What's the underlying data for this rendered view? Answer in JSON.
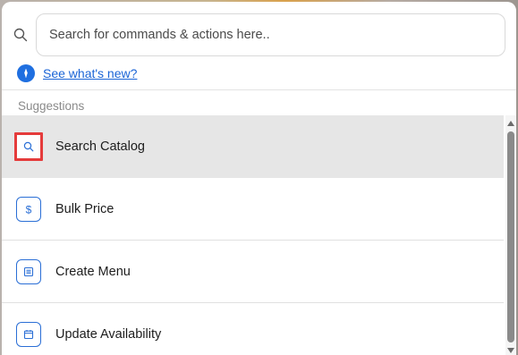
{
  "search": {
    "placeholder": "Search for commands & actions here..",
    "value": ""
  },
  "whats_new": {
    "label": "See what's new?",
    "icon": "sparkle-icon"
  },
  "suggestions": {
    "heading": "Suggestions",
    "items": [
      {
        "label": "Search Catalog",
        "icon": "search-icon",
        "selected": true
      },
      {
        "label": "Bulk Price",
        "icon": "dollar-icon",
        "selected": false
      },
      {
        "label": "Create Menu",
        "icon": "menu-icon",
        "selected": false
      },
      {
        "label": "Update Availability",
        "icon": "calendar-icon",
        "selected": false
      }
    ]
  },
  "colors": {
    "accent": "#1f6fe0",
    "highlight_border": "#e53b3b",
    "selected_bg": "#e6e6e6"
  }
}
